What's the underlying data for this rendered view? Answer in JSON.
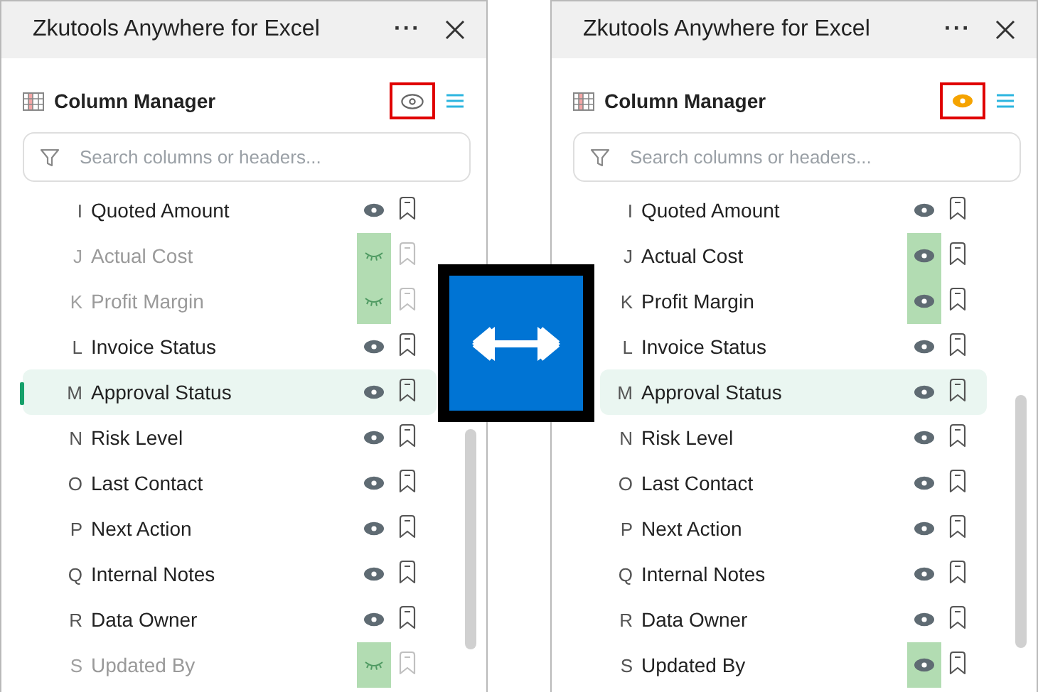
{
  "panels": [
    {
      "title": "Zkutools Anywhere for Excel",
      "more": "···",
      "manager_title": "Column Manager",
      "preview_on": false,
      "search": {
        "placeholder": "Search columns or headers..."
      },
      "rows": [
        {
          "letter": "I",
          "name": "Quoted Amount",
          "hidden": false,
          "highlighted": false,
          "selected": false,
          "marked": false
        },
        {
          "letter": "J",
          "name": "Actual Cost",
          "hidden": true,
          "highlighted": true,
          "selected": false,
          "marked": false
        },
        {
          "letter": "K",
          "name": "Profit Margin",
          "hidden": true,
          "highlighted": true,
          "selected": false,
          "marked": false
        },
        {
          "letter": "L",
          "name": "Invoice Status",
          "hidden": false,
          "highlighted": false,
          "selected": false,
          "marked": false
        },
        {
          "letter": "M",
          "name": "Approval Status",
          "hidden": false,
          "highlighted": false,
          "selected": true,
          "marked": true
        },
        {
          "letter": "N",
          "name": "Risk Level",
          "hidden": false,
          "highlighted": false,
          "selected": false,
          "marked": false
        },
        {
          "letter": "O",
          "name": "Last Contact",
          "hidden": false,
          "highlighted": false,
          "selected": false,
          "marked": false
        },
        {
          "letter": "P",
          "name": "Next Action",
          "hidden": false,
          "highlighted": false,
          "selected": false,
          "marked": false
        },
        {
          "letter": "Q",
          "name": "Internal Notes",
          "hidden": false,
          "highlighted": false,
          "selected": false,
          "marked": false
        },
        {
          "letter": "R",
          "name": "Data Owner",
          "hidden": false,
          "highlighted": false,
          "selected": false,
          "marked": false
        },
        {
          "letter": "S",
          "name": "Updated By",
          "hidden": true,
          "highlighted": true,
          "selected": false,
          "marked": false
        }
      ]
    },
    {
      "title": "Zkutools Anywhere for Excel",
      "more": "···",
      "manager_title": "Column Manager",
      "preview_on": true,
      "search": {
        "placeholder": "Search columns or headers..."
      },
      "rows": [
        {
          "letter": "I",
          "name": "Quoted Amount",
          "hidden": false,
          "highlighted": false,
          "selected": false,
          "marked": false
        },
        {
          "letter": "J",
          "name": "Actual Cost",
          "hidden": false,
          "highlighted": true,
          "selected": false,
          "marked": false
        },
        {
          "letter": "K",
          "name": "Profit Margin",
          "hidden": false,
          "highlighted": true,
          "selected": false,
          "marked": false
        },
        {
          "letter": "L",
          "name": "Invoice Status",
          "hidden": false,
          "highlighted": false,
          "selected": false,
          "marked": false
        },
        {
          "letter": "M",
          "name": "Approval Status",
          "hidden": false,
          "highlighted": false,
          "selected": true,
          "marked": false
        },
        {
          "letter": "N",
          "name": "Risk Level",
          "hidden": false,
          "highlighted": false,
          "selected": false,
          "marked": false
        },
        {
          "letter": "O",
          "name": "Last Contact",
          "hidden": false,
          "highlighted": false,
          "selected": false,
          "marked": false
        },
        {
          "letter": "P",
          "name": "Next Action",
          "hidden": false,
          "highlighted": false,
          "selected": false,
          "marked": false
        },
        {
          "letter": "Q",
          "name": "Internal Notes",
          "hidden": false,
          "highlighted": false,
          "selected": false,
          "marked": false
        },
        {
          "letter": "R",
          "name": "Data Owner",
          "hidden": false,
          "highlighted": false,
          "selected": false,
          "marked": false
        },
        {
          "letter": "S",
          "name": "Updated By",
          "hidden": false,
          "highlighted": true,
          "selected": false,
          "marked": false
        }
      ]
    }
  ]
}
